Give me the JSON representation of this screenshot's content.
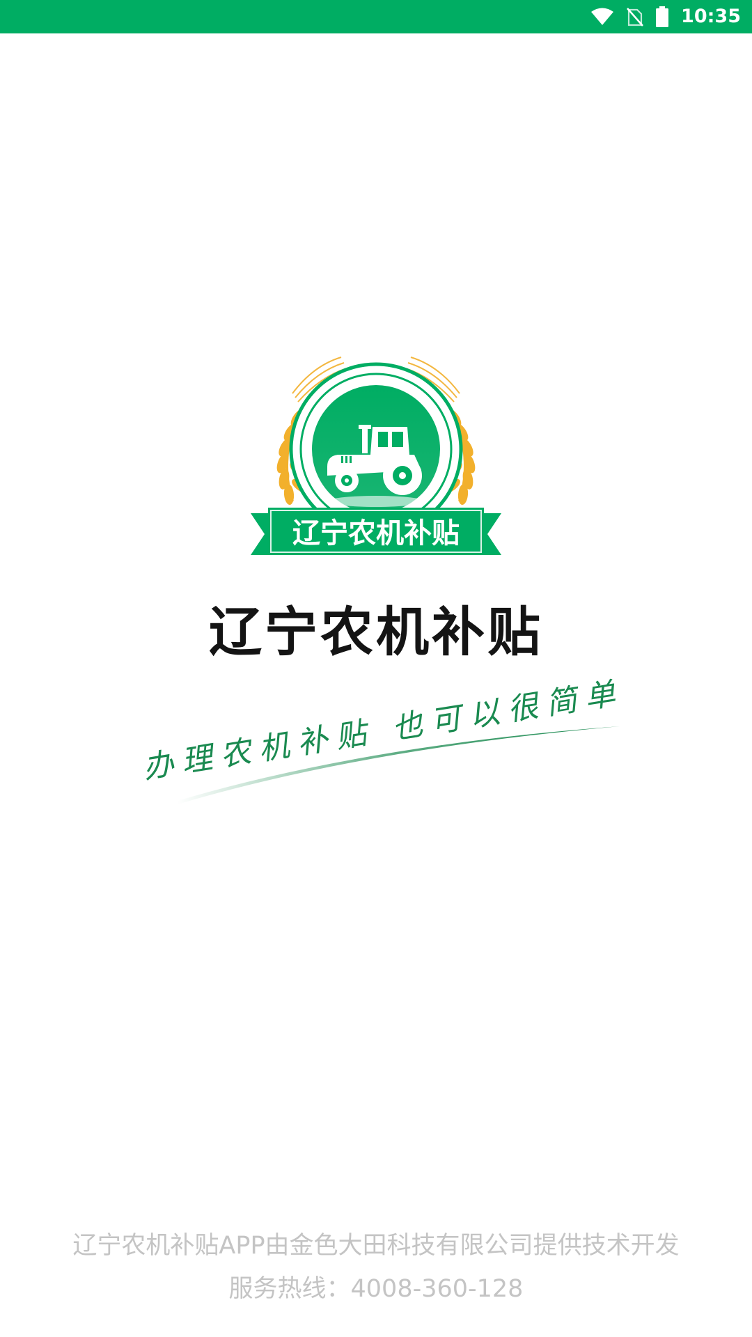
{
  "status_bar": {
    "time": "10:35",
    "background_color": "#00ad63",
    "icons": [
      "wifi-icon",
      "no-sim-icon",
      "battery-icon"
    ]
  },
  "logo": {
    "banner_text": "辽宁农机补贴",
    "icons": [
      "wheat-icon",
      "tractor-icon"
    ],
    "primary_color": "#00ad63",
    "accent_color": "#f2b02c"
  },
  "app_title": "辽宁农机补贴",
  "slogan": "办理农机补贴  也可以很简单",
  "footer": {
    "credit": "辽宁农机补贴APP由金色大田科技有限公司提供技术开发",
    "hotline": "服务热线：4008-360-128"
  }
}
